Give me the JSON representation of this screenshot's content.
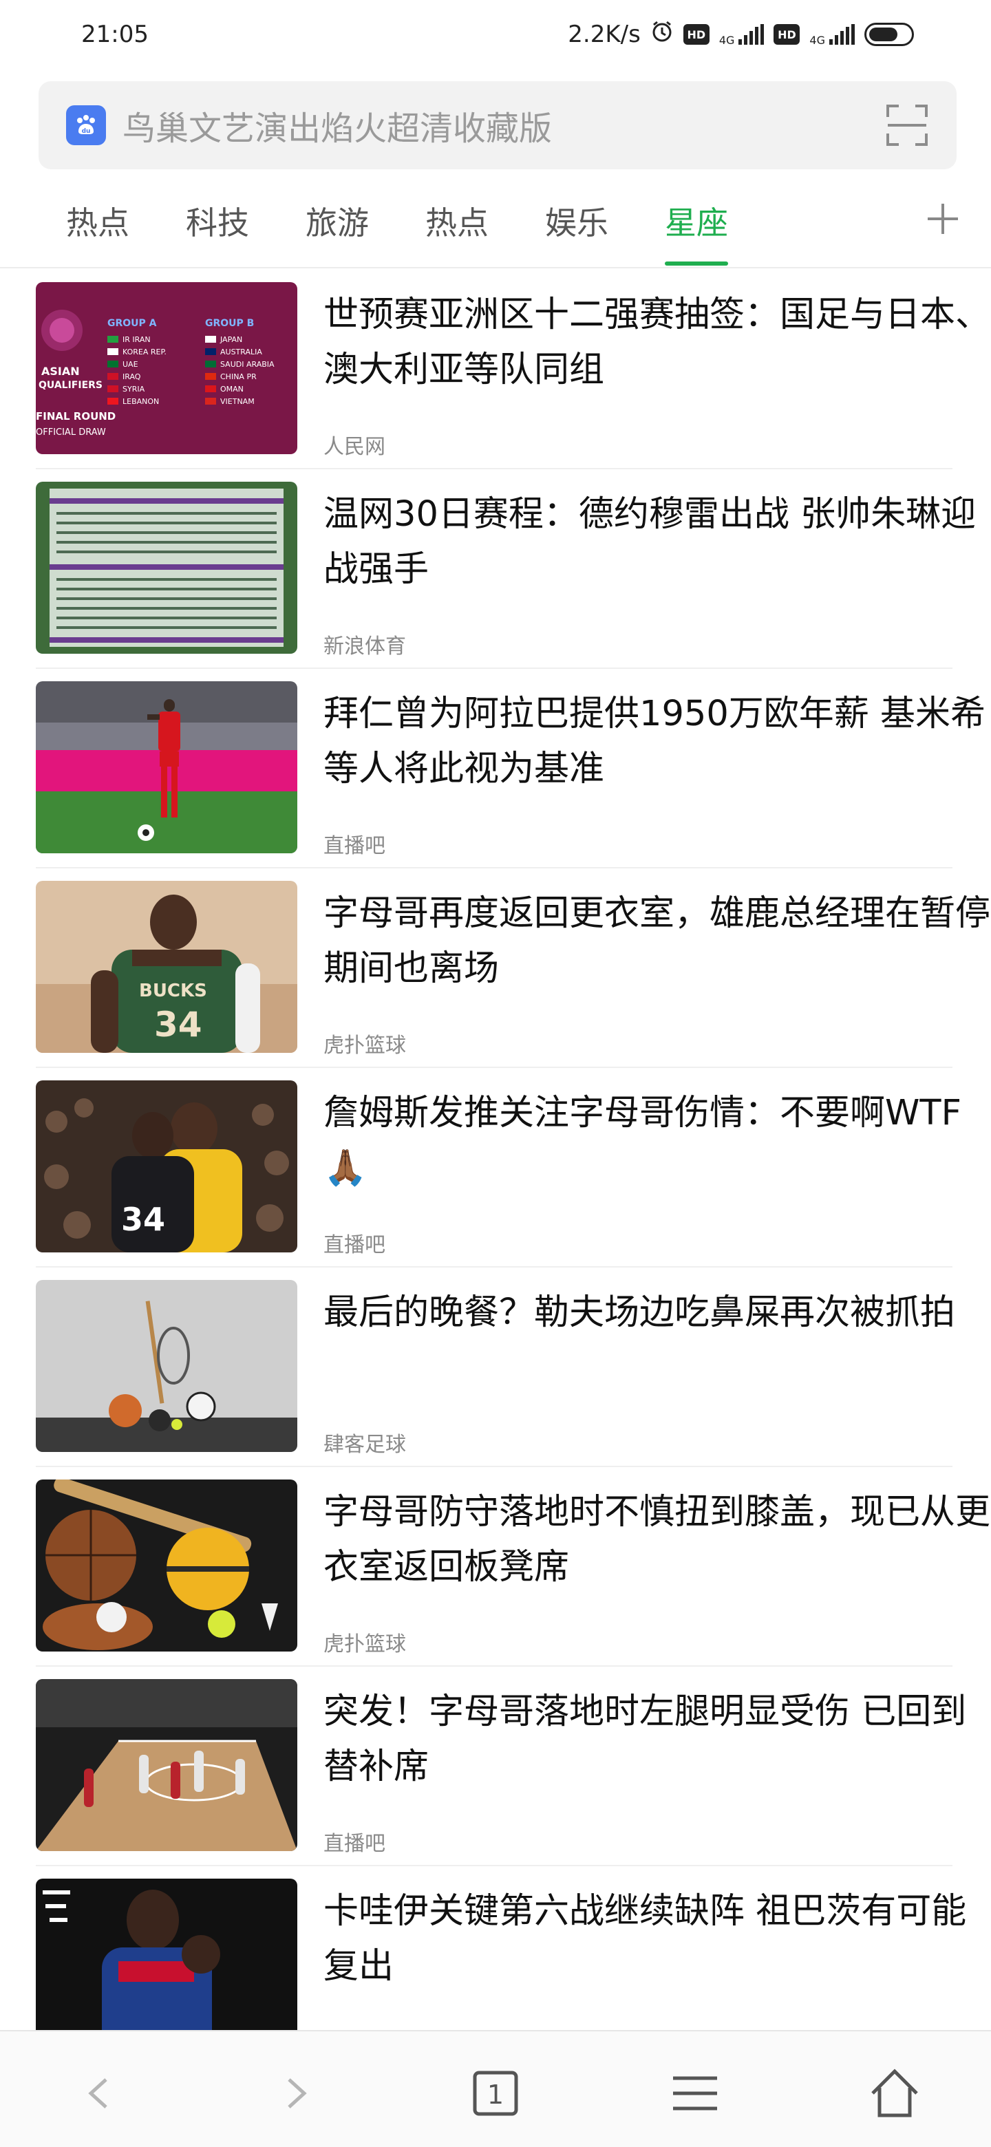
{
  "status_bar": {
    "time": "21:05",
    "net_speed": "2.2K/s",
    "hd1": "HD",
    "net1": "4G",
    "hd2": "HD",
    "net2": "4G"
  },
  "search": {
    "placeholder": "鸟巢文艺演出焰火超清收藏版"
  },
  "tabs": [
    {
      "label": "热点"
    },
    {
      "label": "科技"
    },
    {
      "label": "旅游"
    },
    {
      "label": "热点"
    },
    {
      "label": "娱乐"
    },
    {
      "label": "星座"
    }
  ],
  "active_tab": "星座",
  "accent_color": "#1fae4f",
  "news": [
    {
      "title": "世预赛亚洲区十二强赛抽签：国足与日本、澳大利亚等队同组",
      "source": "人民网"
    },
    {
      "title": "温网30日赛程：德约穆雷出战 张帅朱琳迎战强手",
      "source": "新浪体育"
    },
    {
      "title": "拜仁曾为阿拉巴提供1950万欧年薪 基米希等人将此视为基准",
      "source": "直播吧"
    },
    {
      "title": "字母哥再度返回更衣室，雄鹿总经理在暂停期间也离场",
      "source": "虎扑篮球"
    },
    {
      "title": "詹姆斯发推关注字母哥伤情：不要啊WTF🙏🏾",
      "source": "直播吧"
    },
    {
      "title": "最后的晚餐？勒夫场边吃鼻屎再次被抓拍",
      "source": "肆客足球"
    },
    {
      "title": "字母哥防守落地时不慎扭到膝盖，现已从更衣室返回板凳席",
      "source": "虎扑篮球"
    },
    {
      "title": "突发！字母哥落地时左腿明显受伤 已回到替补席",
      "source": "直播吧"
    },
    {
      "title": "卡哇伊关键第六战继续缺阵 祖巴茨有可能复出",
      "source": ""
    }
  ],
  "thumb_text": {
    "draw_group_a": "GROUP A",
    "draw_group_b": "GROUP B",
    "draw_teams_a": [
      "IR IRAN",
      "KOREA REP.",
      "UAE",
      "IRAQ",
      "SYRIA",
      "LEBANON"
    ],
    "draw_teams_b": [
      "JAPAN",
      "AUSTRALIA",
      "SAUDI ARABIA",
      "CHINA PR",
      "OMAN",
      "VIETNAM"
    ],
    "draw_caption_1": "ASIAN",
    "draw_caption_2": "QUALIFIERS",
    "draw_caption_3": "FINAL ROUND",
    "draw_caption_4": "OFFICIAL DRAW",
    "jersey_number": "34",
    "jersey_team": "BUCKS"
  },
  "bottom_nav": {
    "tab_count": "1"
  }
}
